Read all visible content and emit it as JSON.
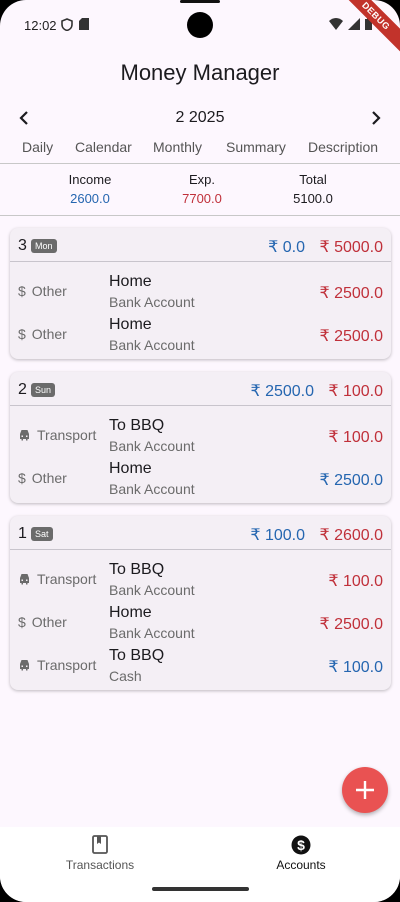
{
  "status_bar": {
    "time": "12:02",
    "debug_label": "DEBUG"
  },
  "app": {
    "title": "Money Manager"
  },
  "month_nav": {
    "label": "2 2025"
  },
  "tabs": [
    "Daily",
    "Calendar",
    "Monthly",
    "Summary",
    "Description"
  ],
  "summary": {
    "income_label": "Income",
    "income_value": "2600.0",
    "expense_label": "Exp.",
    "expense_value": "7700.0",
    "total_label": "Total",
    "total_value": "5100.0"
  },
  "days": [
    {
      "day": "3",
      "weekday": "Mon",
      "income": "₹ 0.0",
      "expense": "₹ 5000.0",
      "transactions": [
        {
          "icon": "dollar-icon",
          "category": "Other",
          "title": "Home",
          "account": "Bank Account",
          "amount": "₹ 2500.0",
          "type": "expense"
        },
        {
          "icon": "dollar-icon",
          "category": "Other",
          "title": "Home",
          "account": "Bank Account",
          "amount": "₹ 2500.0",
          "type": "expense"
        }
      ]
    },
    {
      "day": "2",
      "weekday": "Sun",
      "income": "₹ 2500.0",
      "expense": "₹ 100.0",
      "transactions": [
        {
          "icon": "car-icon",
          "category": "Transport",
          "title": "To BBQ",
          "account": "Bank Account",
          "amount": "₹ 100.0",
          "type": "expense"
        },
        {
          "icon": "dollar-icon",
          "category": "Other",
          "title": "Home",
          "account": "Bank Account",
          "amount": "₹ 2500.0",
          "type": "income"
        }
      ]
    },
    {
      "day": "1",
      "weekday": "Sat",
      "income": "₹ 100.0",
      "expense": "₹ 2600.0",
      "transactions": [
        {
          "icon": "car-icon",
          "category": "Transport",
          "title": "To BBQ",
          "account": "Bank Account",
          "amount": "₹ 100.0",
          "type": "expense"
        },
        {
          "icon": "dollar-icon",
          "category": "Other",
          "title": "Home",
          "account": "Bank Account",
          "amount": "₹ 2500.0",
          "type": "expense"
        },
        {
          "icon": "car-icon",
          "category": "Transport",
          "title": "To BBQ",
          "account": "Cash",
          "amount": "₹ 100.0",
          "type": "income"
        }
      ]
    }
  ],
  "bottom_nav": {
    "transactions_label": "Transactions",
    "accounts_label": "Accounts",
    "active": "accounts"
  },
  "colors": {
    "income": "#2566b0",
    "expense": "#c0303a",
    "fab": "#e95252",
    "background": "#fdf7fe"
  }
}
